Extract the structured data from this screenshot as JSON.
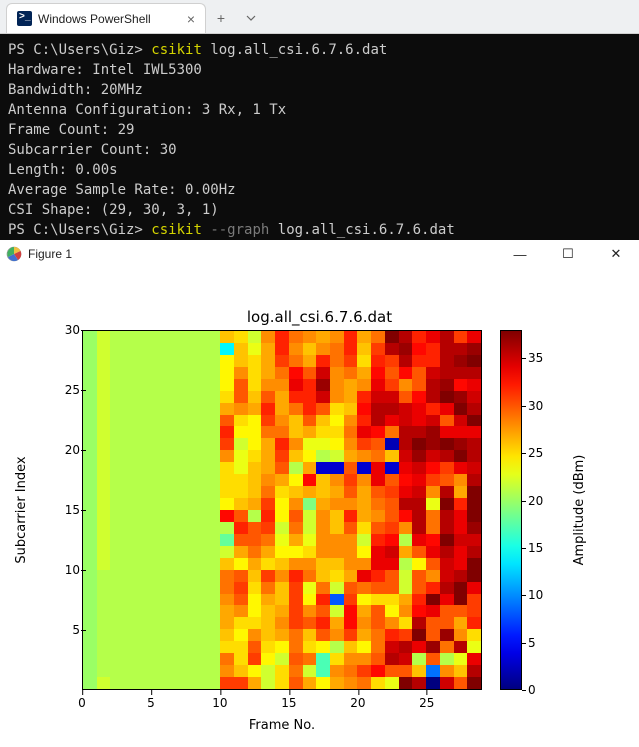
{
  "terminal": {
    "tab_title": "Windows PowerShell",
    "prompt": "PS C:\\Users\\Giz>",
    "cmd1": "csikit",
    "arg1": "log.all_csi.6.7.6.dat",
    "lines": [
      "Hardware: Intel IWL5300",
      "Bandwidth: 20MHz",
      "Antenna Configuration: 3 Rx, 1 Tx",
      "Frame Count: 29",
      "Subcarrier Count: 30",
      "Length: 0.00s",
      "Average Sample Rate: 0.00Hz",
      "CSI Shape: (29, 30, 3, 1)"
    ],
    "cmd2": "csikit",
    "flag2": "--graph",
    "arg2": "log.all_csi.6.7.6.dat"
  },
  "figure": {
    "window_title": "Figure 1"
  },
  "chart_data": {
    "type": "heatmap",
    "title": "log.all_csi.6.7.6.dat",
    "xlabel": "Frame No.",
    "ylabel": "Subcarrier Index",
    "clabel": "Amplitude (dBm)",
    "xlim": [
      0,
      29
    ],
    "ylim": [
      0,
      30
    ],
    "clim": [
      0,
      38
    ],
    "xticks": [
      0,
      5,
      10,
      15,
      20,
      25
    ],
    "yticks": [
      5,
      10,
      15,
      20,
      25,
      30
    ],
    "cticks": [
      0,
      5,
      10,
      15,
      20,
      25,
      30,
      35
    ],
    "nx": 29,
    "ny": 30,
    "values_note": "values[row][col] with row 0 = subcarrier 1 (bottom of plot), col 0 = frame 0",
    "values": [
      [
        20,
        22,
        21,
        21,
        21,
        21,
        21,
        21,
        21,
        21,
        31,
        31,
        27,
        22,
        25,
        30,
        27,
        24,
        27,
        28,
        29,
        25,
        23,
        38,
        36,
        0,
        35,
        30,
        38
      ],
      [
        20,
        21,
        21,
        21,
        21,
        21,
        21,
        21,
        21,
        21,
        28,
        26,
        24,
        22,
        25,
        29,
        22,
        17,
        28,
        29,
        31,
        33,
        30,
        30,
        26,
        9,
        28,
        26,
        36
      ],
      [
        20,
        21,
        21,
        21,
        21,
        21,
        21,
        21,
        21,
        21,
        29,
        25,
        31,
        24,
        22,
        30,
        29,
        17,
        25,
        28,
        28,
        30,
        36,
        35,
        21,
        30,
        21,
        23,
        34
      ],
      [
        20,
        21,
        21,
        21,
        21,
        21,
        21,
        21,
        21,
        21,
        25,
        25,
        30,
        25,
        24,
        29,
        25,
        24,
        21,
        26,
        24,
        29,
        35,
        36,
        34,
        37,
        29,
        36,
        23
      ],
      [
        20,
        21,
        21,
        21,
        21,
        21,
        21,
        21,
        21,
        21,
        26,
        24,
        28,
        26,
        27,
        29,
        26,
        30,
        28,
        31,
        27,
        29,
        32,
        31,
        38,
        30,
        37,
        28,
        25
      ],
      [
        20,
        21,
        21,
        21,
        21,
        21,
        21,
        21,
        21,
        21,
        27,
        25,
        25,
        26,
        28,
        31,
        30,
        32,
        27,
        33,
        28,
        30,
        28,
        25,
        36,
        30,
        30,
        27,
        32
      ],
      [
        20,
        21,
        21,
        21,
        21,
        21,
        21,
        21,
        21,
        21,
        27,
        28,
        24,
        26,
        27,
        31,
        28,
        30,
        22,
        33,
        27,
        30,
        24,
        28,
        33,
        34,
        30,
        30,
        31
      ],
      [
        20,
        21,
        21,
        21,
        21,
        21,
        21,
        21,
        21,
        21,
        28,
        30,
        24,
        27,
        26,
        31,
        24,
        32,
        8,
        31,
        24,
        25,
        25,
        27,
        32,
        38,
        34,
        38,
        31
      ],
      [
        20,
        21,
        21,
        21,
        21,
        21,
        21,
        21,
        21,
        21,
        29,
        31,
        25,
        29,
        26,
        31,
        23,
        29,
        22,
        30,
        29,
        30,
        30,
        22,
        30,
        32,
        36,
        38,
        34
      ],
      [
        20,
        21,
        21,
        21,
        21,
        21,
        21,
        21,
        21,
        21,
        29,
        30,
        26,
        31,
        28,
        32,
        29,
        26,
        25,
        27,
        34,
        32,
        30,
        22,
        30,
        28,
        35,
        36,
        38
      ],
      [
        20,
        22,
        21,
        21,
        21,
        21,
        21,
        21,
        21,
        21,
        26,
        24,
        27,
        25,
        26,
        28,
        28,
        26,
        26,
        28,
        28,
        34,
        34,
        21,
        24,
        30,
        35,
        34,
        38
      ],
      [
        20,
        22,
        21,
        21,
        21,
        21,
        21,
        21,
        21,
        21,
        22,
        27,
        29,
        27,
        24,
        24,
        25,
        28,
        28,
        28,
        24,
        34,
        35,
        27,
        30,
        34,
        36,
        34,
        36
      ],
      [
        20,
        22,
        21,
        21,
        21,
        21,
        21,
        21,
        21,
        21,
        18,
        30,
        30,
        29,
        23,
        27,
        23,
        28,
        28,
        28,
        22,
        32,
        33,
        21,
        34,
        33,
        38,
        35,
        35
      ],
      [
        20,
        22,
        21,
        21,
        21,
        21,
        21,
        21,
        21,
        21,
        21,
        32,
        30,
        31,
        22,
        29,
        22,
        28,
        26,
        30,
        25,
        30,
        31,
        28,
        36,
        29,
        36,
        34,
        37
      ],
      [
        20,
        22,
        21,
        21,
        21,
        21,
        21,
        21,
        21,
        21,
        33,
        30,
        21,
        32,
        24,
        30,
        22,
        28,
        26,
        32,
        27,
        28,
        30,
        33,
        36,
        29,
        36,
        34,
        38
      ],
      [
        20,
        22,
        21,
        21,
        21,
        21,
        21,
        21,
        21,
        21,
        24,
        26,
        27,
        31,
        24,
        28,
        19,
        27,
        28,
        28,
        27,
        29,
        30,
        36,
        36,
        23,
        38,
        32,
        38
      ],
      [
        20,
        22,
        21,
        21,
        21,
        21,
        21,
        21,
        21,
        21,
        25,
        25,
        26,
        29,
        25,
        26,
        27,
        26,
        27,
        30,
        27,
        30,
        31,
        34,
        35,
        28,
        36,
        27,
        38
      ],
      [
        20,
        22,
        21,
        21,
        21,
        21,
        21,
        21,
        21,
        21,
        25,
        25,
        26,
        28,
        27,
        24,
        33,
        26,
        28,
        31,
        28,
        34,
        30,
        33,
        34,
        31,
        30,
        28,
        36
      ],
      [
        20,
        22,
        21,
        21,
        21,
        21,
        21,
        21,
        21,
        21,
        25,
        23,
        26,
        27,
        30,
        21,
        27,
        3,
        3,
        30,
        3,
        34,
        3,
        34,
        35,
        33,
        31,
        34,
        35
      ],
      [
        20,
        22,
        21,
        21,
        21,
        21,
        21,
        21,
        21,
        21,
        28,
        23,
        25,
        27,
        31,
        26,
        24,
        21,
        22,
        27,
        28,
        29,
        26,
        35,
        37,
        35,
        36,
        38,
        36
      ],
      [
        20,
        22,
        21,
        21,
        21,
        21,
        21,
        21,
        21,
        21,
        31,
        22,
        24,
        27,
        32,
        28,
        23,
        23,
        24,
        28,
        31,
        30,
        2,
        36,
        38,
        37,
        38,
        37,
        36
      ],
      [
        20,
        22,
        21,
        21,
        21,
        21,
        21,
        21,
        21,
        21,
        32,
        24,
        24,
        29,
        29,
        26,
        27,
        25,
        25,
        29,
        34,
        33,
        29,
        36,
        36,
        37,
        34,
        34,
        34
      ],
      [
        20,
        22,
        21,
        21,
        21,
        21,
        21,
        21,
        21,
        21,
        30,
        25,
        24,
        31,
        28,
        26,
        30,
        26,
        24,
        28,
        32,
        36,
        34,
        35,
        34,
        35,
        30,
        35,
        38
      ],
      [
        20,
        22,
        21,
        21,
        21,
        21,
        21,
        21,
        21,
        21,
        27,
        28,
        27,
        32,
        27,
        29,
        32,
        30,
        25,
        26,
        33,
        36,
        36,
        35,
        34,
        32,
        34,
        38,
        36
      ],
      [
        20,
        22,
        21,
        21,
        21,
        21,
        21,
        21,
        21,
        21,
        25,
        30,
        26,
        30,
        27,
        32,
        32,
        35,
        28,
        27,
        32,
        35,
        35,
        30,
        33,
        36,
        38,
        37,
        35
      ],
      [
        20,
        22,
        21,
        21,
        21,
        21,
        21,
        21,
        21,
        21,
        24,
        30,
        25,
        28,
        28,
        34,
        32,
        37,
        28,
        27,
        28,
        34,
        31,
        28,
        30,
        36,
        37,
        33,
        34
      ],
      [
        20,
        22,
        21,
        21,
        21,
        21,
        21,
        21,
        21,
        21,
        24,
        28,
        25,
        27,
        29,
        33,
        30,
        35,
        28,
        29,
        27,
        33,
        30,
        33,
        30,
        35,
        36,
        36,
        36
      ],
      [
        20,
        22,
        21,
        21,
        21,
        21,
        21,
        21,
        21,
        21,
        24,
        26,
        25,
        27,
        31,
        29,
        27,
        32,
        29,
        31,
        25,
        32,
        31,
        36,
        32,
        32,
        36,
        37,
        38
      ],
      [
        20,
        22,
        21,
        21,
        21,
        21,
        21,
        21,
        21,
        21,
        14,
        26,
        23,
        27,
        32,
        28,
        26,
        28,
        29,
        32,
        26,
        31,
        36,
        37,
        33,
        32,
        36,
        36,
        37
      ],
      [
        20,
        22,
        21,
        21,
        21,
        21,
        21,
        21,
        21,
        21,
        26,
        25,
        22,
        28,
        32,
        29,
        28,
        27,
        28,
        32,
        27,
        29,
        38,
        36,
        32,
        34,
        36,
        31,
        34
      ]
    ]
  }
}
